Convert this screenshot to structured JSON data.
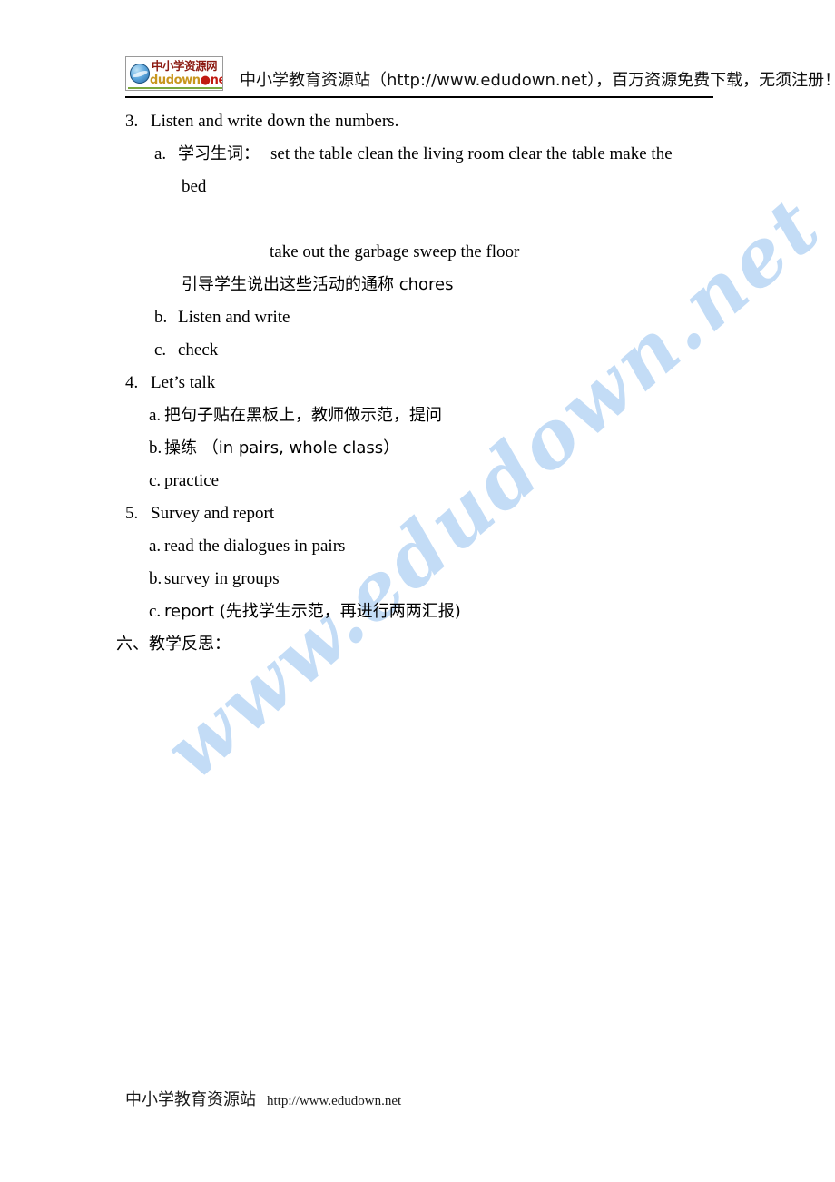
{
  "header": {
    "logo": {
      "line1": "中小学资源网",
      "line2_main": "dudown",
      "line2_dot": "●",
      "line2_net": "net",
      "icon": "ie-globe-icon"
    },
    "banner_text": "中小学教育资源站（http://www.edudown.net），百万资源免费下载，无须注册！"
  },
  "watermark": {
    "text": "www.edudown.net",
    "color": "#c3dcf6"
  },
  "document": {
    "lines": [
      {
        "id": "item-3",
        "indent": "ind-num",
        "marker": "3.",
        "text": "Listen and write down the numbers."
      },
      {
        "id": "item-3a",
        "indent": "ind-let",
        "marker": "a.",
        "text": "学习生词：",
        "tail": "set the table    clean the living room    clear the table      make the"
      },
      {
        "id": "item-3a-cont",
        "indent": "ind-cont",
        "marker": "",
        "text": "bed"
      },
      {
        "id": "blank-1",
        "indent": "ind-cont",
        "marker": "",
        "text": ""
      },
      {
        "id": "item-3a-line2",
        "indent": "ind-deep",
        "marker": "",
        "text": "take out the garbage      sweep the floor"
      },
      {
        "id": "item-3a-line3",
        "indent": "ind-cont",
        "marker": "",
        "text": "引导学生说出这些活动的通称  chores"
      },
      {
        "id": "item-3b",
        "indent": "ind-let",
        "marker": "b.",
        "text": "Listen and write"
      },
      {
        "id": "item-3c",
        "indent": "ind-let",
        "marker": "c.",
        "text": "check"
      },
      {
        "id": "item-4",
        "indent": "ind-num",
        "marker": "4.",
        "text": "Let’s talk"
      },
      {
        "id": "item-4a",
        "indent": "ind-let2",
        "marker": "a.",
        "text": "把句子贴在黑板上，教师做示范，提问"
      },
      {
        "id": "item-4b",
        "indent": "ind-let2",
        "marker": "b.",
        "text": "操练  （in pairs, whole class）"
      },
      {
        "id": "item-4c",
        "indent": "ind-let2",
        "marker": "c.",
        "text": "practice"
      },
      {
        "id": "item-5",
        "indent": "ind-num",
        "marker": "5.",
        "text": "Survey and report"
      },
      {
        "id": "item-5a",
        "indent": "ind-let2",
        "marker": "a.",
        "text": "read the dialogues in pairs"
      },
      {
        "id": "item-5b",
        "indent": "ind-let2",
        "marker": "b.",
        "text": "survey in groups"
      },
      {
        "id": "item-5c",
        "indent": "ind-let2",
        "marker": "c.",
        "text": "report (先找学生示范，再进行两两汇报)"
      },
      {
        "id": "section-6",
        "indent": "ind-root",
        "marker": "",
        "text": "六、教学反思："
      }
    ]
  },
  "footer": {
    "site_name": "中小学教育资源站",
    "url": "http://www.edudown.net"
  }
}
